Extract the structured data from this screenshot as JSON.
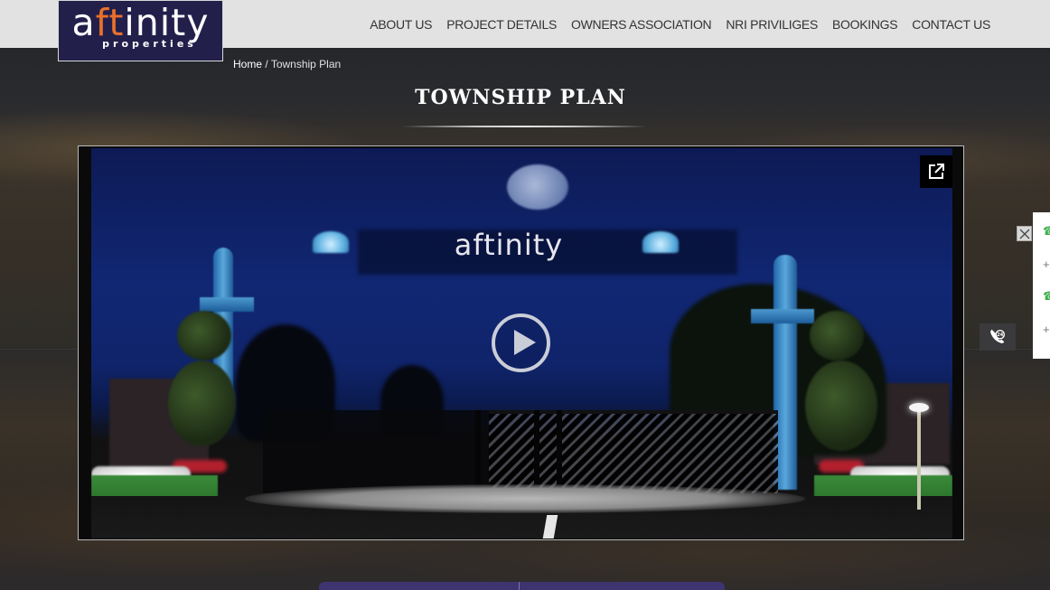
{
  "brand": {
    "logo_prefix": "a",
    "logo_accent": "ft",
    "logo_suffix": "inity",
    "logo_tagline": "properties",
    "logo_bg_color": "#231f4b",
    "accent_color": "#e8702a"
  },
  "nav": {
    "items": [
      {
        "label": "ABOUT US"
      },
      {
        "label": "PROJECT DETAILS"
      },
      {
        "label": "OWNERS ASSOCIATION"
      },
      {
        "label": "NRI PRIVILIGES"
      },
      {
        "label": "BOOKINGS"
      },
      {
        "label": "CONTACT US"
      }
    ]
  },
  "breadcrumb": {
    "home": "Home",
    "separator": " / ",
    "current": "Township Plan"
  },
  "page": {
    "title": "TOWNSHIP PLAN"
  },
  "video": {
    "sign_text": "aftinity",
    "play_icon": "play-circle-icon",
    "popout_icon": "open-in-new-icon"
  },
  "widgets": {
    "close_icon": "close-icon",
    "contact_items": [
      {
        "icon": "phone-icon",
        "glyph": "☎"
      },
      {
        "icon": "plus-icon",
        "glyph": "+"
      },
      {
        "icon": "phone-icon",
        "glyph": "☎"
      },
      {
        "icon": "plus-icon",
        "glyph": "+"
      }
    ],
    "call_icon": "phone-24-icon",
    "call_label": "24"
  }
}
